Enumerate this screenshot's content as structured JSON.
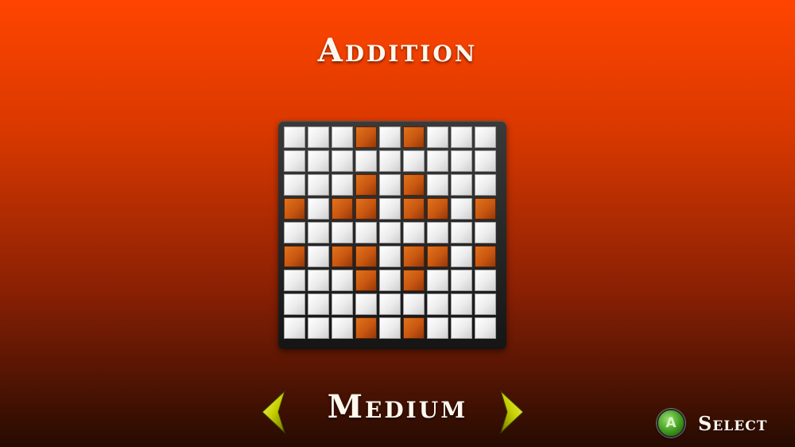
{
  "screen_title": "Addition",
  "grid": {
    "rows": 9,
    "cols": 9,
    "cells": [
      [
        0,
        0,
        0,
        1,
        0,
        1,
        0,
        0,
        0
      ],
      [
        0,
        0,
        0,
        0,
        0,
        0,
        0,
        0,
        0
      ],
      [
        0,
        0,
        0,
        1,
        0,
        1,
        0,
        0,
        0
      ],
      [
        1,
        0,
        1,
        1,
        0,
        1,
        1,
        0,
        1
      ],
      [
        0,
        0,
        0,
        0,
        0,
        0,
        0,
        0,
        0
      ],
      [
        1,
        0,
        1,
        1,
        0,
        1,
        1,
        0,
        1
      ],
      [
        0,
        0,
        0,
        1,
        0,
        1,
        0,
        0,
        0
      ],
      [
        0,
        0,
        0,
        0,
        0,
        0,
        0,
        0,
        0
      ],
      [
        0,
        0,
        0,
        1,
        0,
        1,
        0,
        0,
        0
      ]
    ],
    "colors": {
      "filled": "#c85610",
      "empty": "#ececec"
    }
  },
  "difficulty": {
    "label": "Medium",
    "prev_icon": "chevron-left-icon",
    "next_icon": "chevron-right-icon",
    "arrow_color": "#c8d000"
  },
  "hint": {
    "button_glyph": "A",
    "button_icon": "a-button-icon",
    "label": "Select"
  }
}
